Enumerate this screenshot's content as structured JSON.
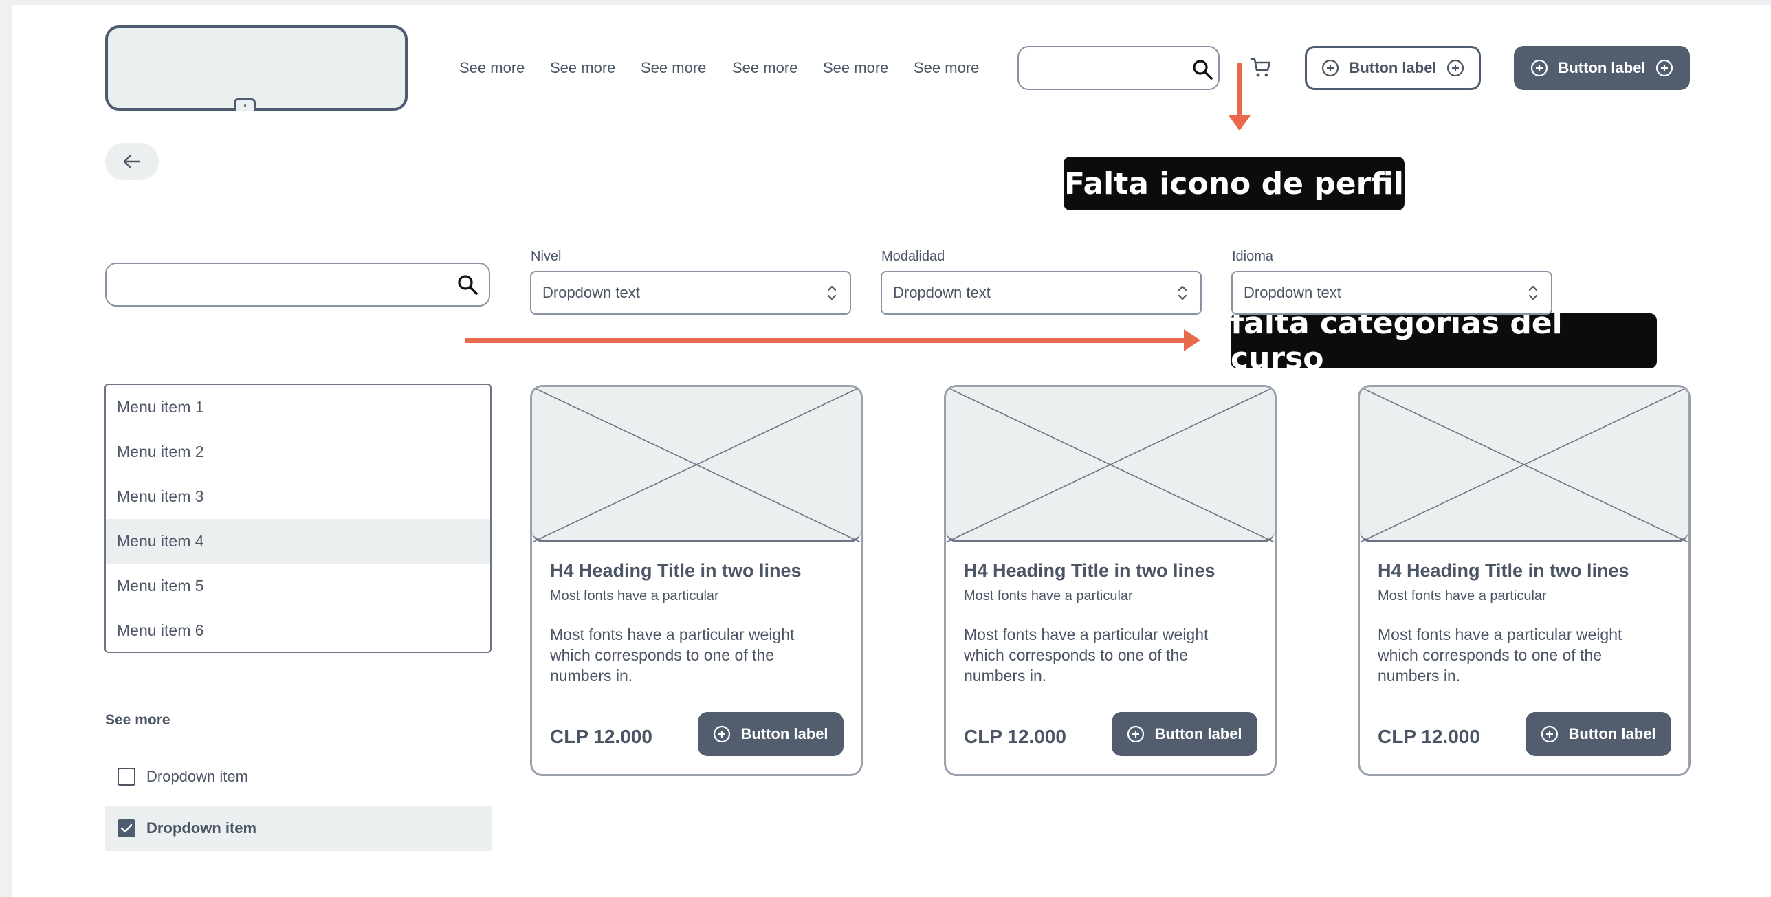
{
  "header": {
    "nav": [
      "See more",
      "See more",
      "See more",
      "See more",
      "See more",
      "See more"
    ],
    "search_placeholder": "",
    "btn_outline_label": "Button label",
    "btn_filled_label": "Button label"
  },
  "annotations": {
    "note_profile": "Falta icono de perfil",
    "note_categories": "falta categorías del curso"
  },
  "filters": {
    "search_placeholder": "",
    "items": [
      {
        "label": "Nivel",
        "value": "Dropdown text"
      },
      {
        "label": "Modalidad",
        "value": "Dropdown text"
      },
      {
        "label": "Idioma",
        "value": "Dropdown text"
      }
    ]
  },
  "sidebar": {
    "menu": [
      "Menu item 1",
      "Menu item 2",
      "Menu item 3",
      "Menu item 4",
      "Menu item 5",
      "Menu item 6"
    ],
    "active_index": 3,
    "see_more": "See more",
    "checks": [
      {
        "label": "Dropdown item",
        "checked": false
      },
      {
        "label": "Dropdown item",
        "checked": true
      }
    ]
  },
  "cards": [
    {
      "title": "H4 Heading Title in two lines",
      "subtitle": "Most fonts have a particular",
      "body": "Most fonts have a particular weight which corresponds to one of the numbers in.",
      "price": "CLP 12.000",
      "button": "Button label"
    },
    {
      "title": "H4 Heading Title in two lines",
      "subtitle": "Most fonts have a particular",
      "body": "Most fonts have a particular weight which corresponds to one of the numbers in.",
      "price": "CLP 12.000",
      "button": "Button label"
    },
    {
      "title": "H4 Heading Title in two lines",
      "subtitle": "Most fonts have a particular",
      "body": "Most fonts have a particular weight which corresponds to one of the numbers in.",
      "price": "CLP 12.000",
      "button": "Button label"
    }
  ],
  "colors": {
    "accent": "#e8694b",
    "primary": "#525d6e",
    "surface": "#ebeff0",
    "annotation_bg": "#0c0c0c"
  }
}
